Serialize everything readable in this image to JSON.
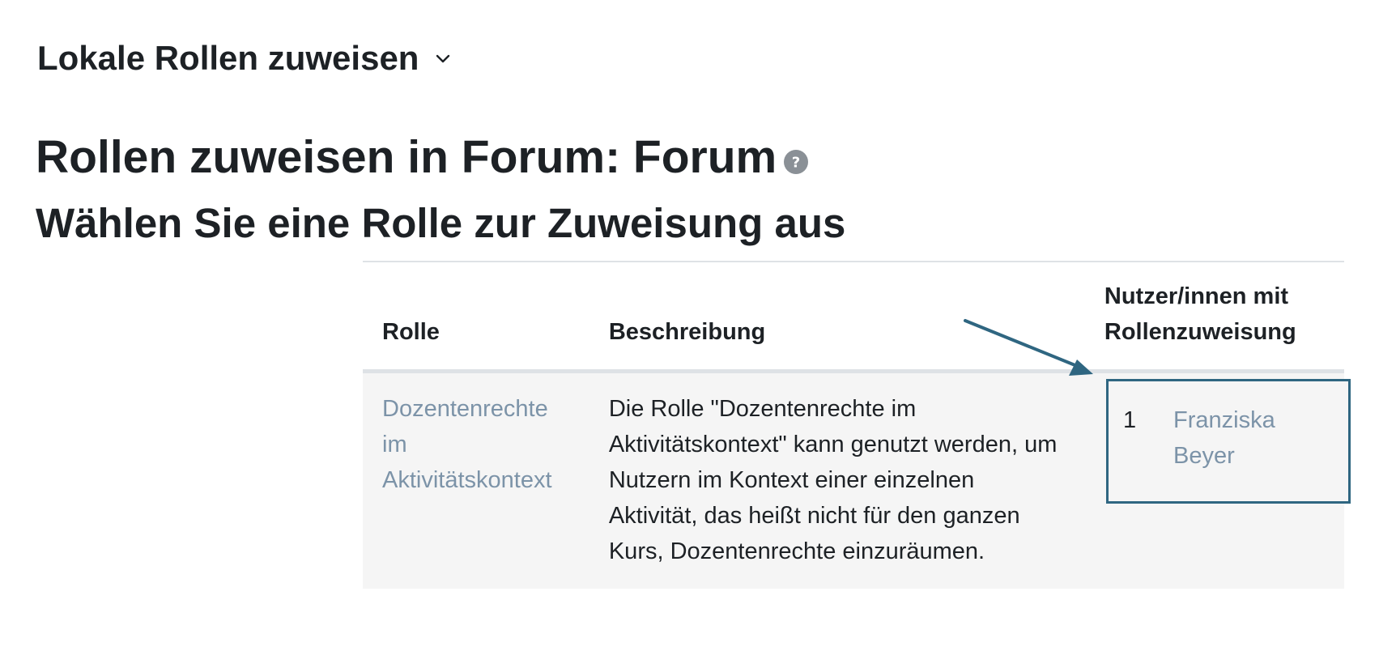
{
  "nav": {
    "title": "Lokale Rollen zuweisen",
    "caret_icon": "chevron-down-icon"
  },
  "page": {
    "heading": "Rollen zuweisen in Forum: Forum",
    "help_icon": "question-circle-icon",
    "subheading": "Wählen Sie eine Rolle zur Zuweisung aus"
  },
  "table": {
    "headers": {
      "role": "Rolle",
      "description": "Beschreibung",
      "users_line1": "Nutzer/innen mit",
      "users_line2": "Rollenzuweisung"
    },
    "rows": [
      {
        "role": "Dozentenrechte im Aktivitätskontext",
        "description": "Die Rolle \"Dozentenrechte im Aktivitätskontext\" kann genutzt werden, um Nutzern im Kontext einer einzelnen Aktivität, das heißt nicht für den ganzen Kurs, Dozentenrechte einzuräumen.",
        "user_count": "1",
        "user_name": "Franziska Beyer"
      }
    ]
  },
  "colors": {
    "text": "#1d2125",
    "link": "#7c93a8",
    "highlight": "#2f6681",
    "row_bg": "#f5f5f5",
    "border": "#dee2e6"
  }
}
